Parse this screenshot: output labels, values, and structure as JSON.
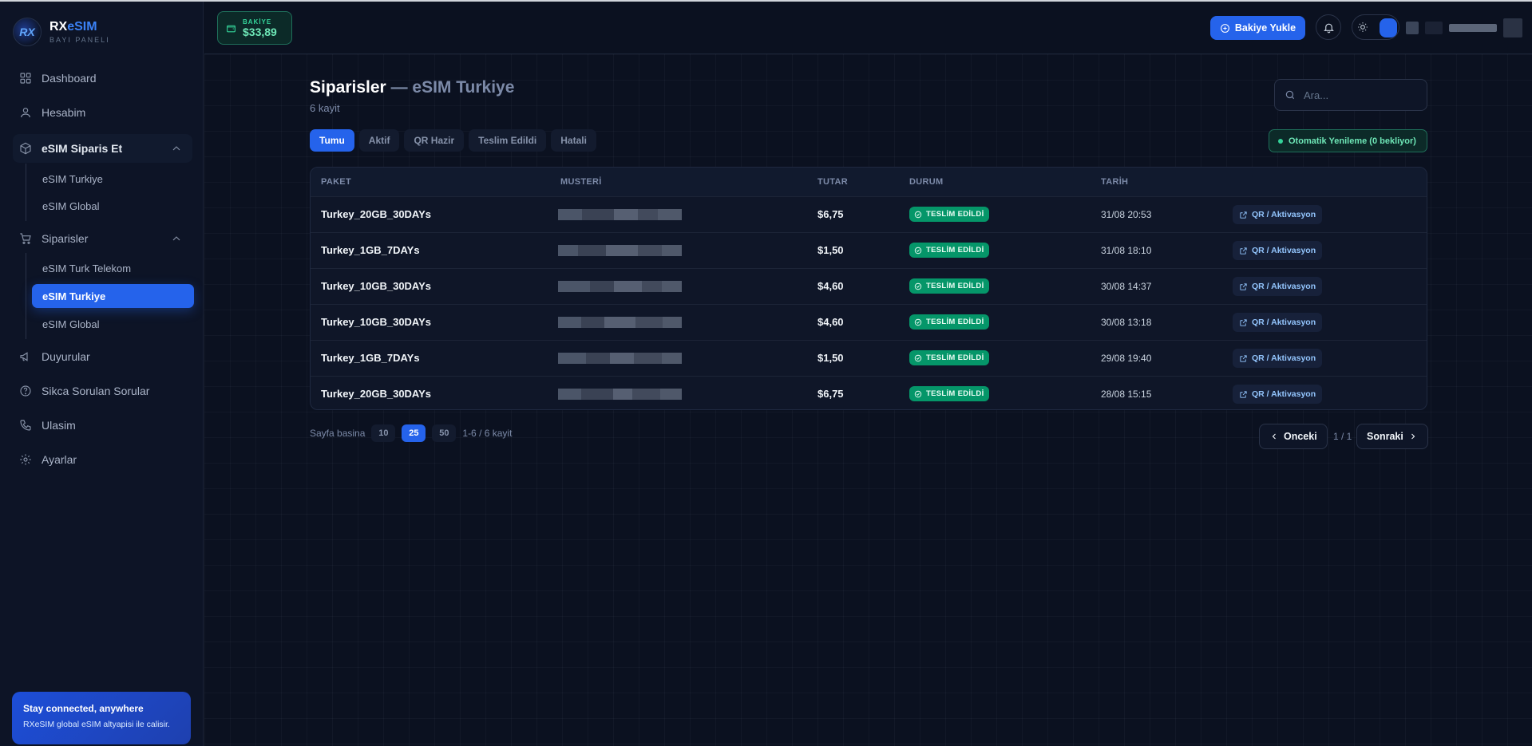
{
  "brand": {
    "name_main": "RX",
    "name_accent": "eSIM",
    "subtitle": "BAYI PANELI",
    "logo_text": "RX"
  },
  "sidebar": {
    "items": [
      {
        "label": "Dashboard",
        "icon": "grid-icon"
      },
      {
        "label": "Hesabim",
        "icon": "user-icon"
      },
      {
        "label": "eSIM Siparis Et",
        "icon": "box-icon",
        "expanded": true,
        "children": [
          {
            "label": "eSIM Turkiye"
          },
          {
            "label": "eSIM Global"
          }
        ]
      },
      {
        "label": "Siparisler",
        "icon": "cart-icon",
        "expanded": true,
        "children": [
          {
            "label": "eSIM Turk Telekom"
          },
          {
            "label": "eSIM Turkiye",
            "active": true
          },
          {
            "label": "eSIM Global"
          }
        ]
      },
      {
        "label": "Duyurular",
        "icon": "megaphone-icon"
      },
      {
        "label": "Sikca Sorulan Sorular",
        "icon": "help-circle-icon"
      },
      {
        "label": "Ulasim",
        "icon": "phone-icon"
      },
      {
        "label": "Ayarlar",
        "icon": "gear-icon"
      }
    ],
    "promo": {
      "title": "Stay connected, anywhere",
      "text": "RXeSIM global eSIM altyapisi ile calisir."
    }
  },
  "header": {
    "balance_label": "BAKİYE",
    "balance_value": "$33,89",
    "topup_label": "Bakiye Yukle"
  },
  "main": {
    "title": "Siparisler",
    "title_dash": "— eSIM Turkiye",
    "subtitle": "6 kayit",
    "search_placeholder": "Ara...",
    "tabs": [
      "Tumu",
      "Aktif",
      "QR Hazir",
      "Teslim Edildi",
      "Hatali"
    ],
    "active_tab": "Tumu",
    "auto_renew": "Otomatik Yenileme (0 bekliyor)",
    "table": {
      "headers": [
        "PAKET",
        "MUSTERİ",
        "TUTAR",
        "DURUM",
        "TARİH"
      ],
      "rows": [
        {
          "package": "Turkey_20GB_30DAYs",
          "amount": "$6,75",
          "status": "TESLİM EDİLDİ",
          "date": "31/08 20:53",
          "action": "QR / Aktivasyon"
        },
        {
          "package": "Turkey_1GB_7DAYs",
          "amount": "$1,50",
          "status": "TESLİM EDİLDİ",
          "date": "31/08 18:10",
          "action": "QR / Aktivasyon"
        },
        {
          "package": "Turkey_10GB_30DAYs",
          "amount": "$4,60",
          "status": "TESLİM EDİLDİ",
          "date": "30/08 14:37",
          "action": "QR / Aktivasyon"
        },
        {
          "package": "Turkey_10GB_30DAYs",
          "amount": "$4,60",
          "status": "TESLİM EDİLDİ",
          "date": "30/08 13:18",
          "action": "QR / Aktivasyon"
        },
        {
          "package": "Turkey_1GB_7DAYs",
          "amount": "$1,50",
          "status": "TESLİM EDİLDİ",
          "date": "29/08 19:40",
          "action": "QR / Aktivasyon"
        },
        {
          "package": "Turkey_20GB_30DAYs",
          "amount": "$6,75",
          "status": "TESLİM EDİLDİ",
          "date": "28/08 15:15",
          "action": "QR / Aktivasyon"
        }
      ]
    },
    "pagination": {
      "per_page_label": "Sayfa basina",
      "sizes": [
        "10",
        "25",
        "50"
      ],
      "active_size": "25",
      "range": "1-6 / 6 kayit",
      "prev": "Onceki",
      "next": "Sonraki",
      "page": "1 / 1"
    }
  },
  "colors": {
    "accent": "#2563eb",
    "success": "#059669",
    "background": "#0b1120"
  }
}
